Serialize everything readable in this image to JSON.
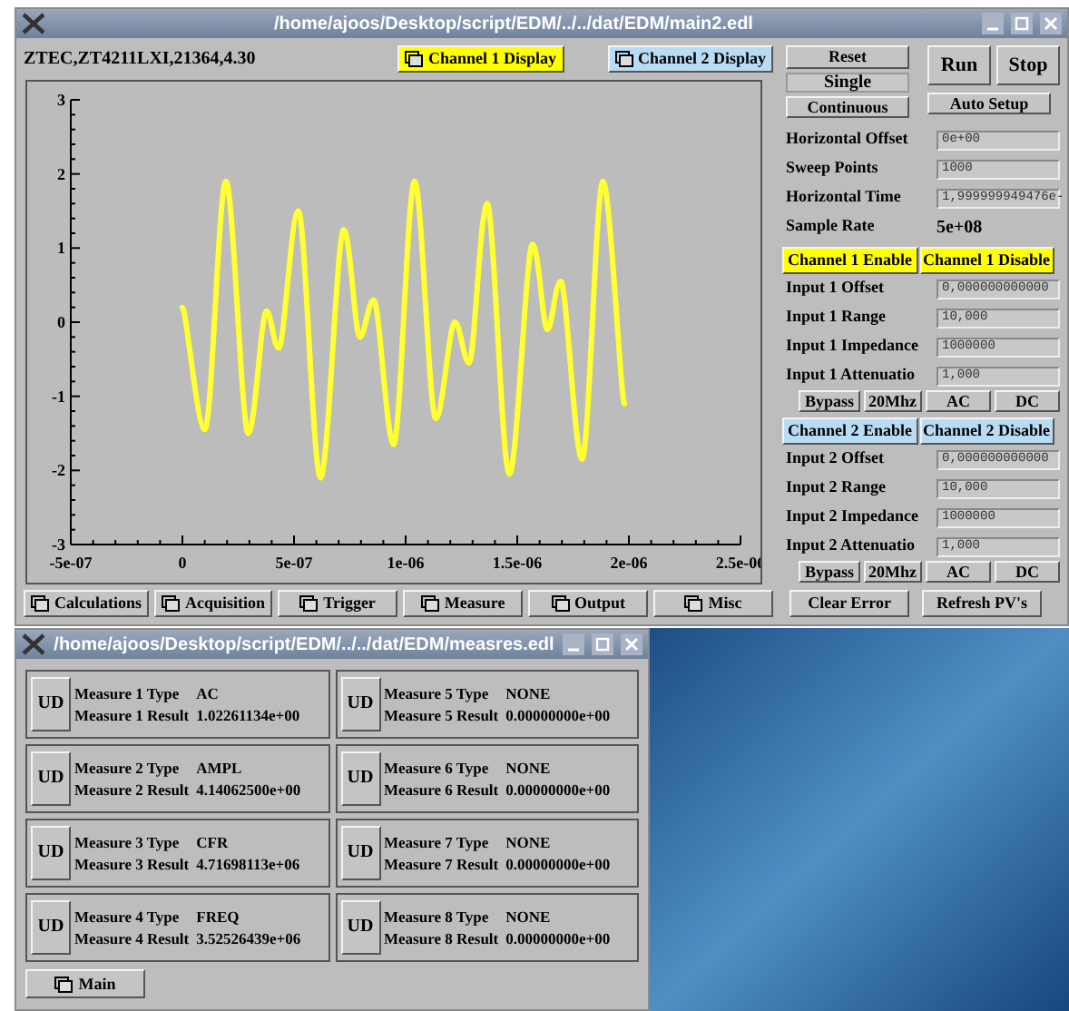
{
  "main_window": {
    "title": "/home/ajoos/Desktop/script/EDM/../../dat/EDM/main2.edl",
    "device_id": "ZTEC,ZT4211LXI,21364,4.30",
    "display_buttons": [
      {
        "label": "Channel 1 Display",
        "color": "#ffff00"
      },
      {
        "label": "Channel 2 Display",
        "color": "#b8dcf4"
      }
    ],
    "chart_data": {
      "type": "line",
      "xlim": [
        -5e-07,
        2.5e-06
      ],
      "ylim": [
        -3,
        3
      ],
      "xticks": [
        {
          "value": -5e-07,
          "label": "-5e-07"
        },
        {
          "value": 0,
          "label": "0"
        },
        {
          "value": 5e-07,
          "label": "5e-07"
        },
        {
          "value": 1e-06,
          "label": "1e-06"
        },
        {
          "value": 1.5e-06,
          "label": "1.5e-06"
        },
        {
          "value": 2e-06,
          "label": "2e-06"
        },
        {
          "value": 2.5e-06,
          "label": "2.5e-06"
        }
      ],
      "yticks": [
        -3,
        -2,
        -1,
        0,
        1,
        2,
        3
      ],
      "x": [
        0,
        1e-07,
        1.95e-07,
        2.95e-07,
        3.76e-07,
        4.32e-07,
        5.19e-07,
        6.19e-07,
        7.22e-07,
        7.95e-07,
        8.57e-07,
        9.46e-07,
        1.04e-06,
        1.135e-06,
        1.22e-06,
        1.284e-06,
        1.365e-06,
        1.465e-06,
        1.568e-06,
        1.635e-06,
        1.695e-06,
        1.79e-06,
        1.884e-06,
        1.98e-06
      ],
      "series": [
        {
          "color": "#ffff33",
          "values": [
            0.2,
            -1.45,
            1.9,
            -1.5,
            0.15,
            -0.35,
            1.5,
            -2.1,
            1.25,
            -0.2,
            0.3,
            -1.65,
            1.9,
            -1.3,
            0,
            -0.55,
            1.6,
            -2.05,
            1.05,
            -0.1,
            0.55,
            -1.85,
            1.9,
            -1.1
          ]
        }
      ]
    },
    "controls": {
      "reset": "Reset",
      "single": "Single",
      "continuous": "Continuous",
      "run": "Run",
      "stop": "Stop",
      "auto_setup": "Auto Setup"
    },
    "horizontal": [
      {
        "label": "Horizontal Offset",
        "value": "0e+00",
        "kind": "field"
      },
      {
        "label": "Sweep Points",
        "value": "1000",
        "kind": "field"
      },
      {
        "label": "Horizontal Time",
        "value": "1,999999949476e-",
        "kind": "field"
      },
      {
        "label": "Sample Rate",
        "value": "5e+08",
        "kind": "readout"
      }
    ],
    "channels": [
      {
        "enable": "Channel 1 Enable",
        "disable": "Channel 1 Disable",
        "color": "#ffff00",
        "inputs": [
          {
            "label": "Input 1 Offset",
            "value": "0,000000000000"
          },
          {
            "label": "Input 1 Range",
            "value": "10,000"
          },
          {
            "label": "Input 1 Impedance",
            "value": "1000000"
          },
          {
            "label": "Input 1 Attenuatio",
            "value": "1,000"
          }
        ],
        "coupling": [
          "Bypass",
          "20Mhz",
          "AC",
          "DC"
        ]
      },
      {
        "enable": "Channel 2 Enable",
        "disable": "Channel 2 Disable",
        "color": "#b8dcf4",
        "inputs": [
          {
            "label": "Input 2 Offset",
            "value": "0,000000000000"
          },
          {
            "label": "Input 2 Range",
            "value": "10,000"
          },
          {
            "label": "Input 2 Impedance",
            "value": "1000000"
          },
          {
            "label": "Input 2 Attenuatio",
            "value": "1,000"
          }
        ],
        "coupling": [
          "Bypass",
          "20Mhz",
          "AC",
          "DC"
        ]
      }
    ],
    "nav_buttons": [
      "Calculations",
      "Acquisition",
      "Trigger",
      "Measure",
      "Output",
      "Misc"
    ],
    "action_buttons": [
      "Clear Error",
      "Refresh PV's"
    ]
  },
  "measure_window": {
    "title": "/home/ajoos/Desktop/script/EDM/../../dat/EDM/measres.edl",
    "measures": [
      {
        "button": "UD",
        "type_label": "Measure 1 Type",
        "type": "AC",
        "result_label": "Measure 1 Result",
        "result": "1.02261134e+00"
      },
      {
        "button": "UD",
        "type_label": "Measure 2 Type",
        "type": "AMPL",
        "result_label": "Measure 2 Result",
        "result": "4.14062500e+00"
      },
      {
        "button": "UD",
        "type_label": "Measure 3 Type",
        "type": "CFR",
        "result_label": "Measure 3 Result",
        "result": "4.71698113e+06"
      },
      {
        "button": "UD",
        "type_label": "Measure 4 Type",
        "type": "FREQ",
        "result_label": "Measure 4 Result",
        "result": "3.52526439e+06"
      },
      {
        "button": "UD",
        "type_label": "Measure 5 Type",
        "type": "NONE",
        "result_label": "Measure 5 Result",
        "result": "0.00000000e+00"
      },
      {
        "button": "UD",
        "type_label": "Measure 6 Type",
        "type": "NONE",
        "result_label": "Measure 6 Result",
        "result": "0.00000000e+00"
      },
      {
        "button": "UD",
        "type_label": "Measure 7 Type",
        "type": "NONE",
        "result_label": "Measure 7 Result",
        "result": "0.00000000e+00"
      },
      {
        "button": "UD",
        "type_label": "Measure 8 Type",
        "type": "NONE",
        "result_label": "Measure 8 Result",
        "result": "0.00000000e+00"
      }
    ],
    "main_button": "Main"
  }
}
